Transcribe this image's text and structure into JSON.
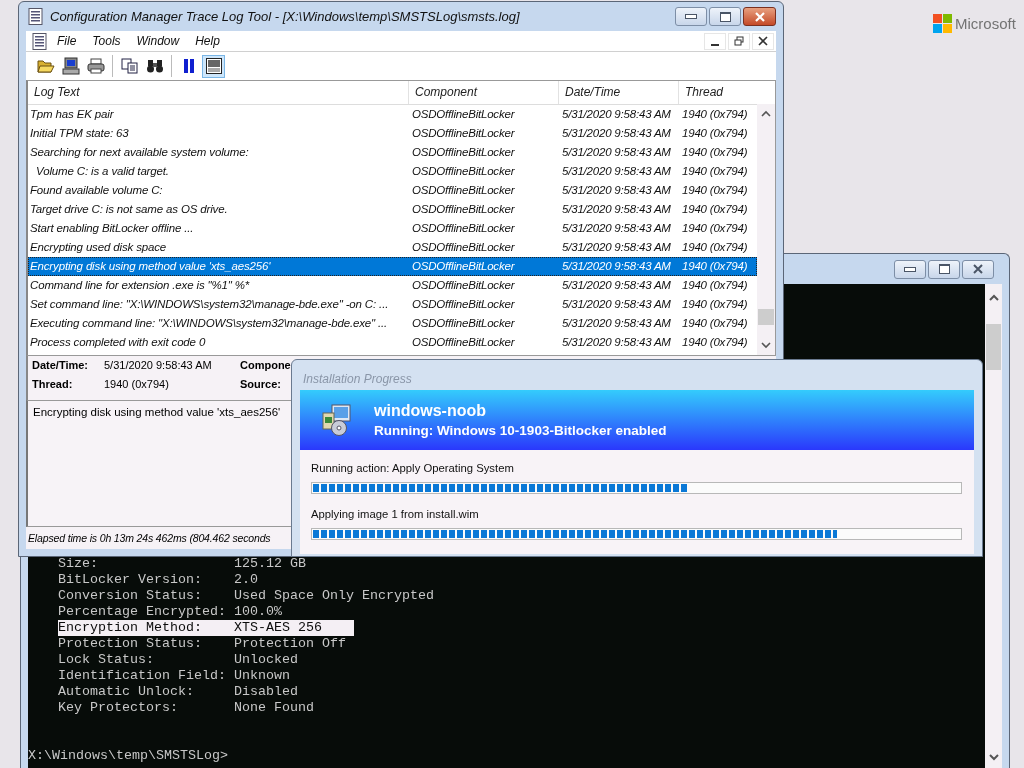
{
  "desktop": {
    "logo_text": "Microsoft"
  },
  "console": {
    "lines": [
      {
        "label": "Size:",
        "value": "125.12 GB",
        "selected": false
      },
      {
        "label": "BitLocker Version:",
        "value": "2.0",
        "selected": false
      },
      {
        "label": "Conversion Status:",
        "value": "Used Space Only Encrypted",
        "selected": false
      },
      {
        "label": "Percentage Encrypted:",
        "value": "100.0%",
        "selected": false
      },
      {
        "label": "Encryption Method:",
        "value": "XTS-AES 256",
        "selected": true
      },
      {
        "label": "Protection Status:",
        "value": "Protection Off",
        "selected": false
      },
      {
        "label": "Lock Status:",
        "value": "Unlocked",
        "selected": false
      },
      {
        "label": "Identification Field:",
        "value": "Unknown",
        "selected": false
      },
      {
        "label": "Automatic Unlock:",
        "value": "Disabled",
        "selected": false
      },
      {
        "label": "Key Protectors:",
        "value": "None Found",
        "selected": false
      }
    ],
    "prompt": "X:\\Windows\\temp\\SMSTSLog>"
  },
  "log_window": {
    "title": "Configuration Manager Trace Log Tool - [X:\\Windows\\temp\\SMSTSLog\\smsts.log]",
    "menu": [
      "File",
      "Tools",
      "Window",
      "Help"
    ],
    "toolbar": [
      {
        "pressed": false
      },
      {
        "pressed": false
      },
      {
        "pressed": false
      },
      {
        "pressed": false
      },
      {
        "pressed": false
      },
      {
        "pressed": false
      },
      {
        "pressed": true
      }
    ],
    "columns": [
      "Log Text",
      "Component",
      "Date/Time",
      "Thread"
    ],
    "rows": [
      {
        "text": "Tpm has EK pair",
        "component": "OSDOfflineBitLocker",
        "datetime": "5/31/2020 9:58:43 AM",
        "thread": "1940 (0x794)",
        "selected": false
      },
      {
        "text": "Initial TPM state: 63",
        "component": "OSDOfflineBitLocker",
        "datetime": "5/31/2020 9:58:43 AM",
        "thread": "1940 (0x794)",
        "selected": false
      },
      {
        "text": "Searching for next available system volume:",
        "component": "OSDOfflineBitLocker",
        "datetime": "5/31/2020 9:58:43 AM",
        "thread": "1940 (0x794)",
        "selected": false
      },
      {
        "text": "  Volume C: is a valid target.",
        "component": "OSDOfflineBitLocker",
        "datetime": "5/31/2020 9:58:43 AM",
        "thread": "1940 (0x794)",
        "selected": false
      },
      {
        "text": "Found available volume C:",
        "component": "OSDOfflineBitLocker",
        "datetime": "5/31/2020 9:58:43 AM",
        "thread": "1940 (0x794)",
        "selected": false
      },
      {
        "text": "Target drive C: is not same as OS drive.",
        "component": "OSDOfflineBitLocker",
        "datetime": "5/31/2020 9:58:43 AM",
        "thread": "1940 (0x794)",
        "selected": false
      },
      {
        "text": "Start enabling BitLocker offline ...",
        "component": "OSDOfflineBitLocker",
        "datetime": "5/31/2020 9:58:43 AM",
        "thread": "1940 (0x794)",
        "selected": false
      },
      {
        "text": "Encrypting used disk space",
        "component": "OSDOfflineBitLocker",
        "datetime": "5/31/2020 9:58:43 AM",
        "thread": "1940 (0x794)",
        "selected": false
      },
      {
        "text": "Encrypting disk using method value 'xts_aes256'",
        "component": "OSDOfflineBitLocker",
        "datetime": "5/31/2020 9:58:43 AM",
        "thread": "1940 (0x794)",
        "selected": true
      },
      {
        "text": "Command line for extension .exe is \"%1\" %*",
        "component": "OSDOfflineBitLocker",
        "datetime": "5/31/2020 9:58:43 AM",
        "thread": "1940 (0x794)",
        "selected": false
      },
      {
        "text": "Set command line: \"X:\\WINDOWS\\system32\\manage-bde.exe\" -on C: ...",
        "component": "OSDOfflineBitLocker",
        "datetime": "5/31/2020 9:58:43 AM",
        "thread": "1940 (0x794)",
        "selected": false
      },
      {
        "text": "Executing command line: \"X:\\WINDOWS\\system32\\manage-bde.exe\" ...",
        "component": "OSDOfflineBitLocker",
        "datetime": "5/31/2020 9:58:43 AM",
        "thread": "1940 (0x794)",
        "selected": false
      },
      {
        "text": "Process completed with exit code 0",
        "component": "OSDOfflineBitLocker",
        "datetime": "5/31/2020 9:58:43 AM",
        "thread": "1940 (0x794)",
        "selected": false
      }
    ],
    "details": {
      "datetime_label": "Date/Time:",
      "datetime": "5/31/2020 9:58:43 AM",
      "component_label": "Compone",
      "thread_label": "Thread:",
      "thread": "1940 (0x794)",
      "source_label": "Source:"
    },
    "message": "Encrypting disk using method value 'xts_aes256'",
    "status": "Elapsed time is 0h 13m 24s 462ms (804.462 seconds"
  },
  "progress_dialog": {
    "title": "Installation Progress",
    "org": "windows-noob",
    "sequence": "Running: Windows 10-1903-Bitlocker enabled",
    "steps": [
      {
        "label": "Running action: Apply Operating System",
        "level": 0.58
      },
      {
        "label": "Applying image 1 from install.wim",
        "level": 0.81
      }
    ]
  }
}
